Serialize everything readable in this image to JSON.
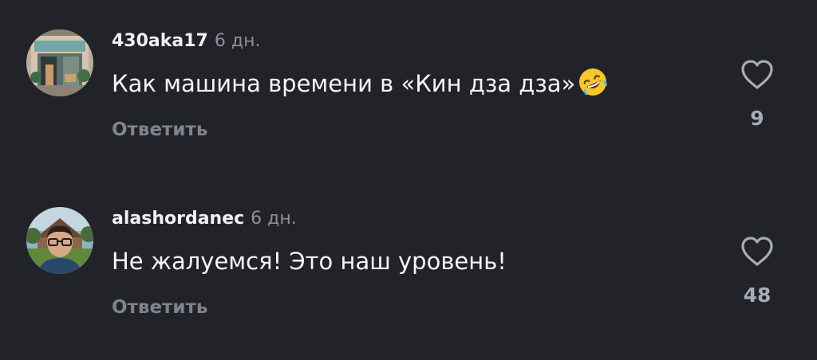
{
  "comments": [
    {
      "username": "430aka17",
      "time": "6 дн.",
      "text": "Как машина времени в «Кин дза дза»",
      "emoji": "rolling-on-floor-laughing-emoji",
      "reply_label": "Ответить",
      "likes": "9"
    },
    {
      "username": "alashordanec",
      "time": "6 дн.",
      "text": "Не жалуемся! Это наш уровень!",
      "reply_label": "Ответить",
      "likes": "48"
    }
  ],
  "colors": {
    "background": "#222329",
    "text": "#f4f5f7",
    "muted": "#8b8f99",
    "heart_outline": "#a7abb4"
  }
}
